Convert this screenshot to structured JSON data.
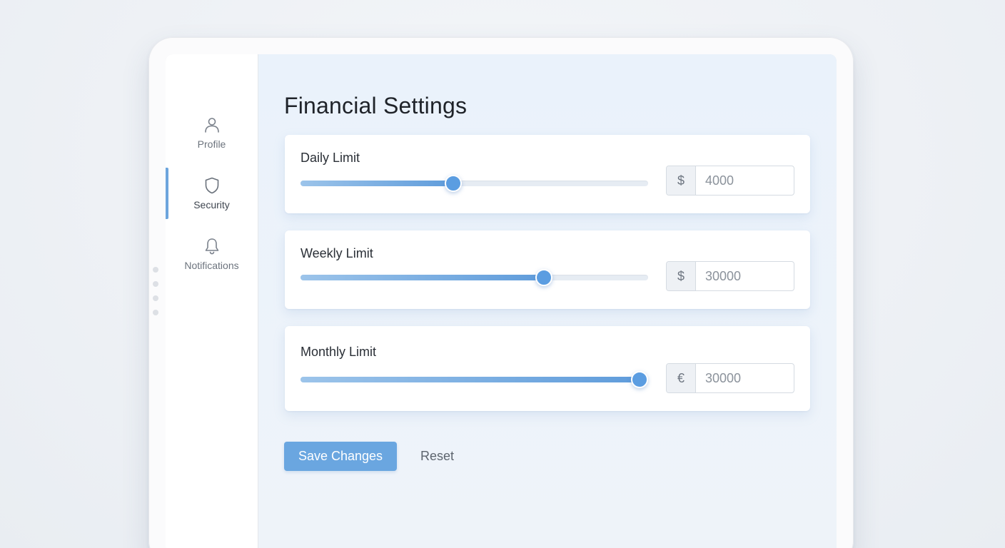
{
  "page": {
    "title": "Financial Settings"
  },
  "sidebar": {
    "items": [
      {
        "label": "Profile",
        "icon": "user-icon",
        "active": false
      },
      {
        "label": "Security",
        "icon": "shield-icon",
        "active": true
      },
      {
        "label": "Notifications",
        "icon": "bell-icon",
        "active": false
      }
    ]
  },
  "limits": [
    {
      "label": "Daily Limit",
      "currency": "$",
      "value": "4000",
      "slider_fraction": 0.44
    },
    {
      "label": "Weekly Limit",
      "currency": "$",
      "value": "30000",
      "slider_fraction": 0.7
    },
    {
      "label": "Monthly Limit",
      "currency": "€",
      "value": "30000",
      "slider_fraction": 0.975
    }
  ],
  "actions": {
    "save_label": "Save Changes",
    "reset_label": "Reset"
  },
  "colors": {
    "accent": "#5b9de1",
    "button": "#6aa6e0",
    "active_indicator": "#6da5dd"
  }
}
